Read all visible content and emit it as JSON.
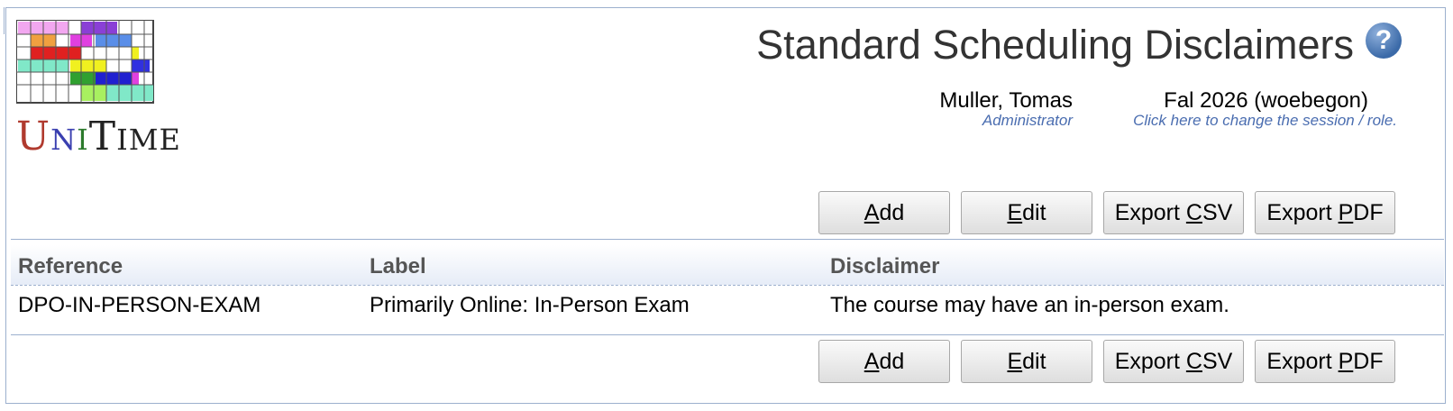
{
  "app": {
    "logo_text": "UniTime",
    "page_title": "Standard Scheduling Disclaimers"
  },
  "user": {
    "name": "Muller, Tomas",
    "role": "Administrator"
  },
  "session": {
    "name": "Fal 2026 (woebegon)",
    "hint": "Click here to change the session / role."
  },
  "buttons": {
    "add": {
      "pre": "",
      "key": "A",
      "post": "dd"
    },
    "edit": {
      "pre": "",
      "key": "E",
      "post": "dit"
    },
    "export_csv": {
      "pre": "Export ",
      "key": "C",
      "post": "SV"
    },
    "export_pdf": {
      "pre": "Export ",
      "key": "P",
      "post": "DF"
    }
  },
  "table": {
    "columns": [
      "Reference",
      "Label",
      "Disclaimer"
    ],
    "rows": [
      [
        "DPO-IN-PERSON-EXAM",
        "Primarily Online: In-Person Exam",
        "The course may have an in-person exam."
      ]
    ]
  }
}
